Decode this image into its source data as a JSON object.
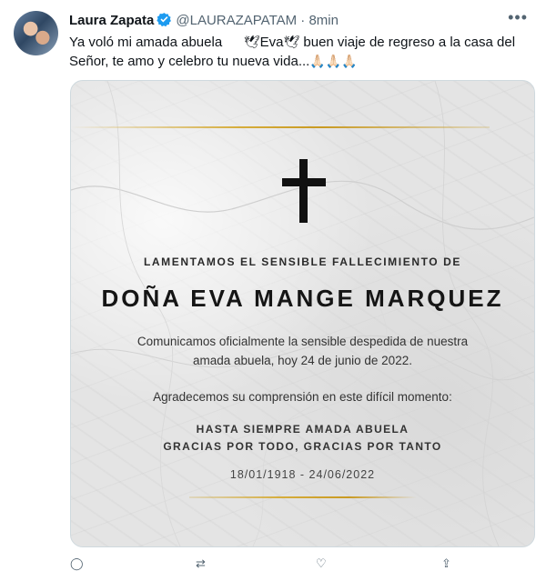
{
  "tweet": {
    "author_name": "Laura Zapata",
    "handle": "@LAURAZAPATAM",
    "separator": "·",
    "time": "8min",
    "more_icon": "more-horizontal-icon",
    "line1": "Ya voló mi amada abuela",
    "line1_eva": "Eva",
    "line1_rest": "buen viaje de regreso a la casa del",
    "line2": "Señor, te amo y celebro tu nueva vida...",
    "emojis": [
      "dove-emoji",
      "folded-hands-emoji"
    ]
  },
  "card": {
    "subtitle": "LAMENTAMOS EL SENSIBLE FALLECIMIENTO DE",
    "name": "DOÑA EVA MANGE MARQUEZ",
    "message1_line1": "Comunicamos oficialmente la sensible despedida de nuestra",
    "message1_line2": "amada abuela, hoy 24 de junio de 2022.",
    "message2": "Agradecemos su comprensión en este difícil momento:",
    "closing1": "HASTA SIEMPRE AMADA ABUELA",
    "closing2": "GRACIAS POR TODO, GRACIAS POR TANTO",
    "dates": "18/01/1918 - 24/06/2022",
    "colors": {
      "gold": "#d6ad3c",
      "marble": "#e4e4e4",
      "cross": "#111111"
    }
  }
}
